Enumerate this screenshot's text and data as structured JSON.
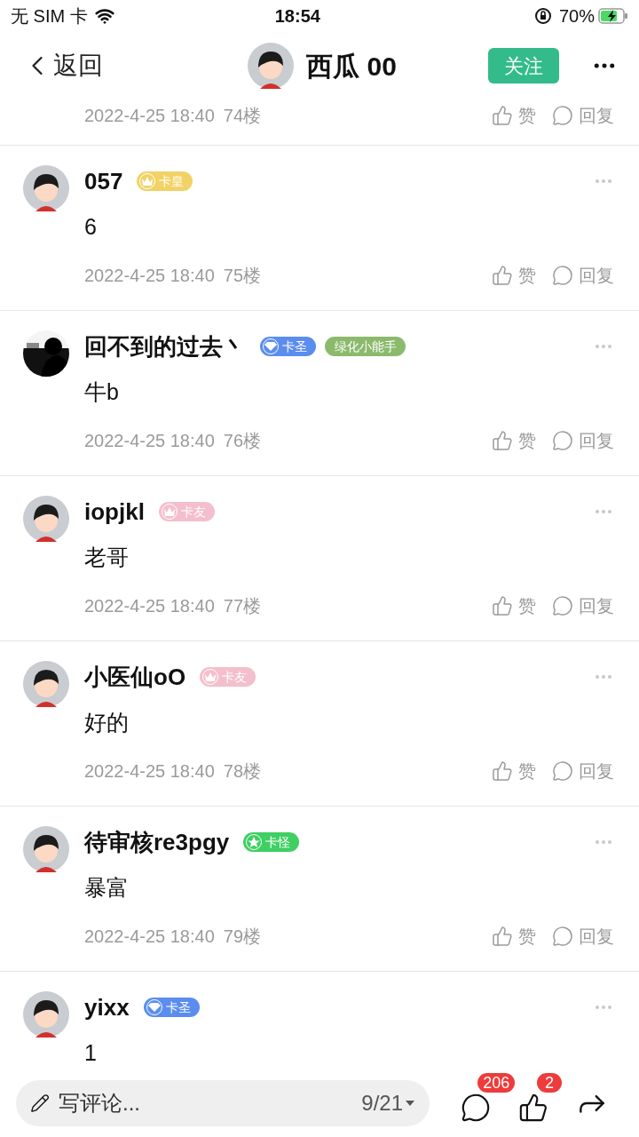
{
  "status_bar": {
    "carrier": "无 SIM 卡",
    "time": "18:54",
    "battery": "70%"
  },
  "header": {
    "back": "返回",
    "title": "西瓜 00",
    "follow": "关注"
  },
  "top_partial": {
    "date": "2022-4-25 18:40",
    "floor": "74楼",
    "like": "赞",
    "reply": "回复"
  },
  "comments": [
    {
      "avatar": {
        "kind": "cartoon"
      },
      "name": "057",
      "badges": [
        {
          "label": "卡皇",
          "kind": "crown",
          "color": "#f2d266"
        }
      ],
      "body": "6",
      "date": "2022-4-25 18:40",
      "floor": "75楼",
      "like": "赞",
      "reply": "回复"
    },
    {
      "name": "回不到的过去丶",
      "badges": [
        {
          "label": "卡圣",
          "kind": "diamond",
          "color": "#5b8def"
        },
        {
          "label": "绿化小能手",
          "kind": "plain",
          "color": "#8cba6c"
        }
      ],
      "body": "牛b",
      "date": "2022-4-25 18:40",
      "floor": "76楼",
      "like": "赞",
      "reply": "回复"
    },
    {
      "avatar": {
        "kind": "cartoon"
      },
      "name": "iopjkl",
      "badges": [
        {
          "label": "卡友",
          "kind": "crown",
          "color": "#f4bfcd"
        }
      ],
      "body": "老哥",
      "date": "2022-4-25 18:40",
      "floor": "77楼",
      "like": "赞",
      "reply": "回复"
    },
    {
      "avatar": {
        "kind": "cartoon"
      },
      "name": "小医仙oO",
      "badges": [
        {
          "label": "卡友",
          "kind": "crown",
          "color": "#f4bfcd"
        }
      ],
      "body": "好的",
      "date": "2022-4-25 18:40",
      "floor": "78楼",
      "like": "赞",
      "reply": "回复"
    },
    {
      "avatar": {
        "kind": "cartoon"
      },
      "name": "待审核re3pgy",
      "badges": [
        {
          "label": "卡怪",
          "kind": "star",
          "color": "#3fcf63"
        }
      ],
      "body": "暴富",
      "date": "2022-4-25 18:40",
      "floor": "79楼",
      "like": "赞",
      "reply": "回复"
    },
    {
      "avatar": {
        "kind": "cartoon"
      },
      "name": "yixx",
      "badges": [
        {
          "label": "卡圣",
          "kind": "diamond",
          "color": "#5b8def"
        }
      ],
      "body": "1"
    }
  ],
  "bottom_bar": {
    "placeholder": "写评论...",
    "page": "9/21",
    "comment_count": "206",
    "like_count": "2"
  }
}
